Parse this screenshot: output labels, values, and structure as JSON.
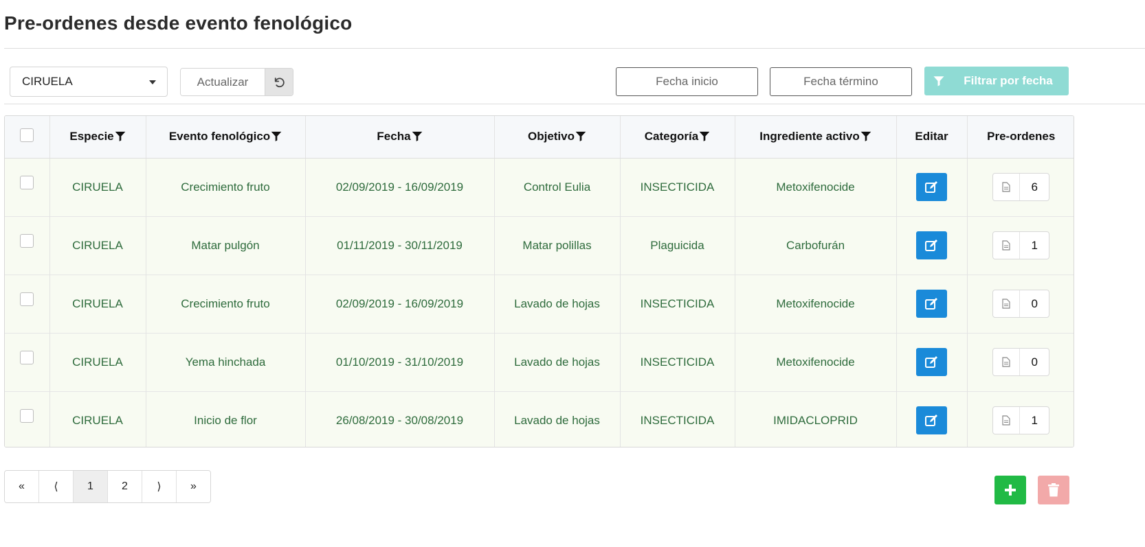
{
  "page": {
    "title": "Pre-ordenes desde evento fenológico"
  },
  "toolbar": {
    "species_select": {
      "value": "CIRUELA"
    },
    "refresh": {
      "label": "Actualizar",
      "icon": "undo-icon"
    },
    "date_start": {
      "placeholder": "Fecha inicio"
    },
    "date_end": {
      "placeholder": "Fecha término"
    },
    "filter_button": {
      "label": "Filtrar por fecha",
      "icon": "filter-icon",
      "color": "#8fdbd4"
    }
  },
  "table": {
    "headers": {
      "especie": "Especie",
      "evento": "Evento fenológico",
      "fecha": "Fecha",
      "objetivo": "Objetivo",
      "categoria": "Categoría",
      "ingrediente": "Ingrediente activo",
      "editar": "Editar",
      "preordenes": "Pre-ordenes"
    },
    "rows": [
      {
        "especie": "CIRUELA",
        "evento": "Crecimiento fruto",
        "fecha": "02/09/2019 - 16/09/2019",
        "objetivo": "Control Eulia",
        "categoria": "INSECTICIDA",
        "ingrediente": "Metoxifenocide",
        "preordenes": "6"
      },
      {
        "especie": "CIRUELA",
        "evento": "Matar pulgón",
        "fecha": "01/11/2019 - 30/11/2019",
        "objetivo": "Matar polillas",
        "categoria": "Plaguicida",
        "ingrediente": "Carbofurán",
        "preordenes": "1"
      },
      {
        "especie": "CIRUELA",
        "evento": "Crecimiento fruto",
        "fecha": "02/09/2019 - 16/09/2019",
        "objetivo": "Lavado de hojas",
        "categoria": "INSECTICIDA",
        "ingrediente": "Metoxifenocide",
        "preordenes": "0"
      },
      {
        "especie": "CIRUELA",
        "evento": "Yema hinchada",
        "fecha": "01/10/2019 - 31/10/2019",
        "objetivo": "Lavado de hojas",
        "categoria": "INSECTICIDA",
        "ingrediente": "Metoxifenocide",
        "preordenes": "0"
      },
      {
        "especie": "CIRUELA",
        "evento": "Inicio de flor",
        "fecha": "26/08/2019 - 30/08/2019",
        "objetivo": "Lavado de hojas",
        "categoria": "INSECTICIDA",
        "ingrediente": "IMIDACLOPRID",
        "preordenes": "1"
      }
    ],
    "edit_button_color": "#1a8ad9",
    "row_text_color": "#2e6b3c"
  },
  "pagination": {
    "first": "«",
    "prev": "⟨",
    "pages": [
      "1",
      "2"
    ],
    "current": "1",
    "next": "⟩",
    "last": "»"
  },
  "actions": {
    "add": {
      "icon": "plus-icon",
      "color": "#21ba45"
    },
    "delete": {
      "icon": "trash-icon",
      "color": "#f2a9a9"
    }
  }
}
